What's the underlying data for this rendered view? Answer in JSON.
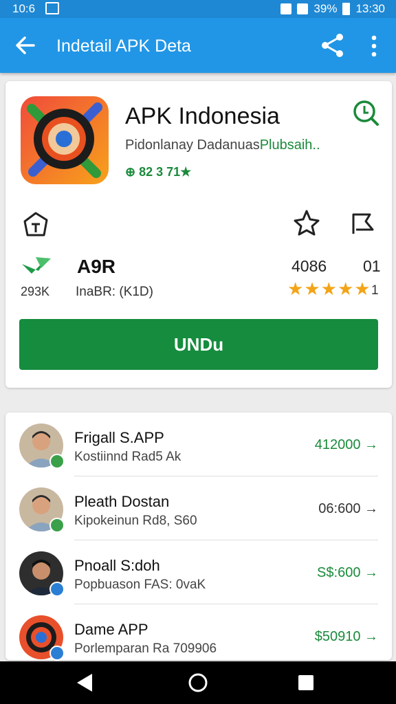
{
  "status": {
    "time": "10:6",
    "battery": "39%",
    "clock": "13:30"
  },
  "app_bar": {
    "title": "Indetail APK Deta"
  },
  "app": {
    "name": "APK Indonesia",
    "developer_prefix": "Pidonlanay Dadanuas",
    "developer_link": "Plubsaih..",
    "badge": "⊕ 82 3 71★"
  },
  "stats": {
    "main": "A9R",
    "count": "293K",
    "sub": "InaBR: (K1D)",
    "rating": "4086",
    "rating_extra": "01",
    "stars": 5,
    "rating_tail": "1"
  },
  "download_label": "UNDu",
  "list": [
    {
      "name": "Frigall S.APP",
      "sub": "Kostiinnd Rad5 Ak",
      "price": "412000 →",
      "price_color": "#1a8a3a",
      "dot_color": "#3aa04a",
      "avatar": "person"
    },
    {
      "name": "Pleath Dostan",
      "sub": "Kipokeinun Rd8, S60",
      "price": "06:600 →",
      "price_color": "#333333",
      "dot_color": "#3aa04a",
      "avatar": "person"
    },
    {
      "name": "Pnoall S:doh",
      "sub": "Popbuason FAS: 0vaK",
      "price": "S$:600 →",
      "price_color": "#1a8a3a",
      "dot_color": "#2a7fd4",
      "avatar": "person-dark"
    },
    {
      "name": "Dame APP",
      "sub": "Porlemparan Ra 709906",
      "price": "$50910 →",
      "price_color": "#1a8a3a",
      "dot_color": "#2a7fd4",
      "avatar": "app"
    }
  ],
  "colors": {
    "app_bar": "#2196e6",
    "accent_green": "#158c3e",
    "star": "#f3a417"
  },
  "icons": [
    "back-arrow-icon",
    "share-icon",
    "more-vert-icon",
    "search-icon",
    "house-icon",
    "star-outline-icon",
    "flag-icon",
    "check-icon",
    "back-nav-icon",
    "home-nav-icon",
    "recents-nav-icon"
  ]
}
